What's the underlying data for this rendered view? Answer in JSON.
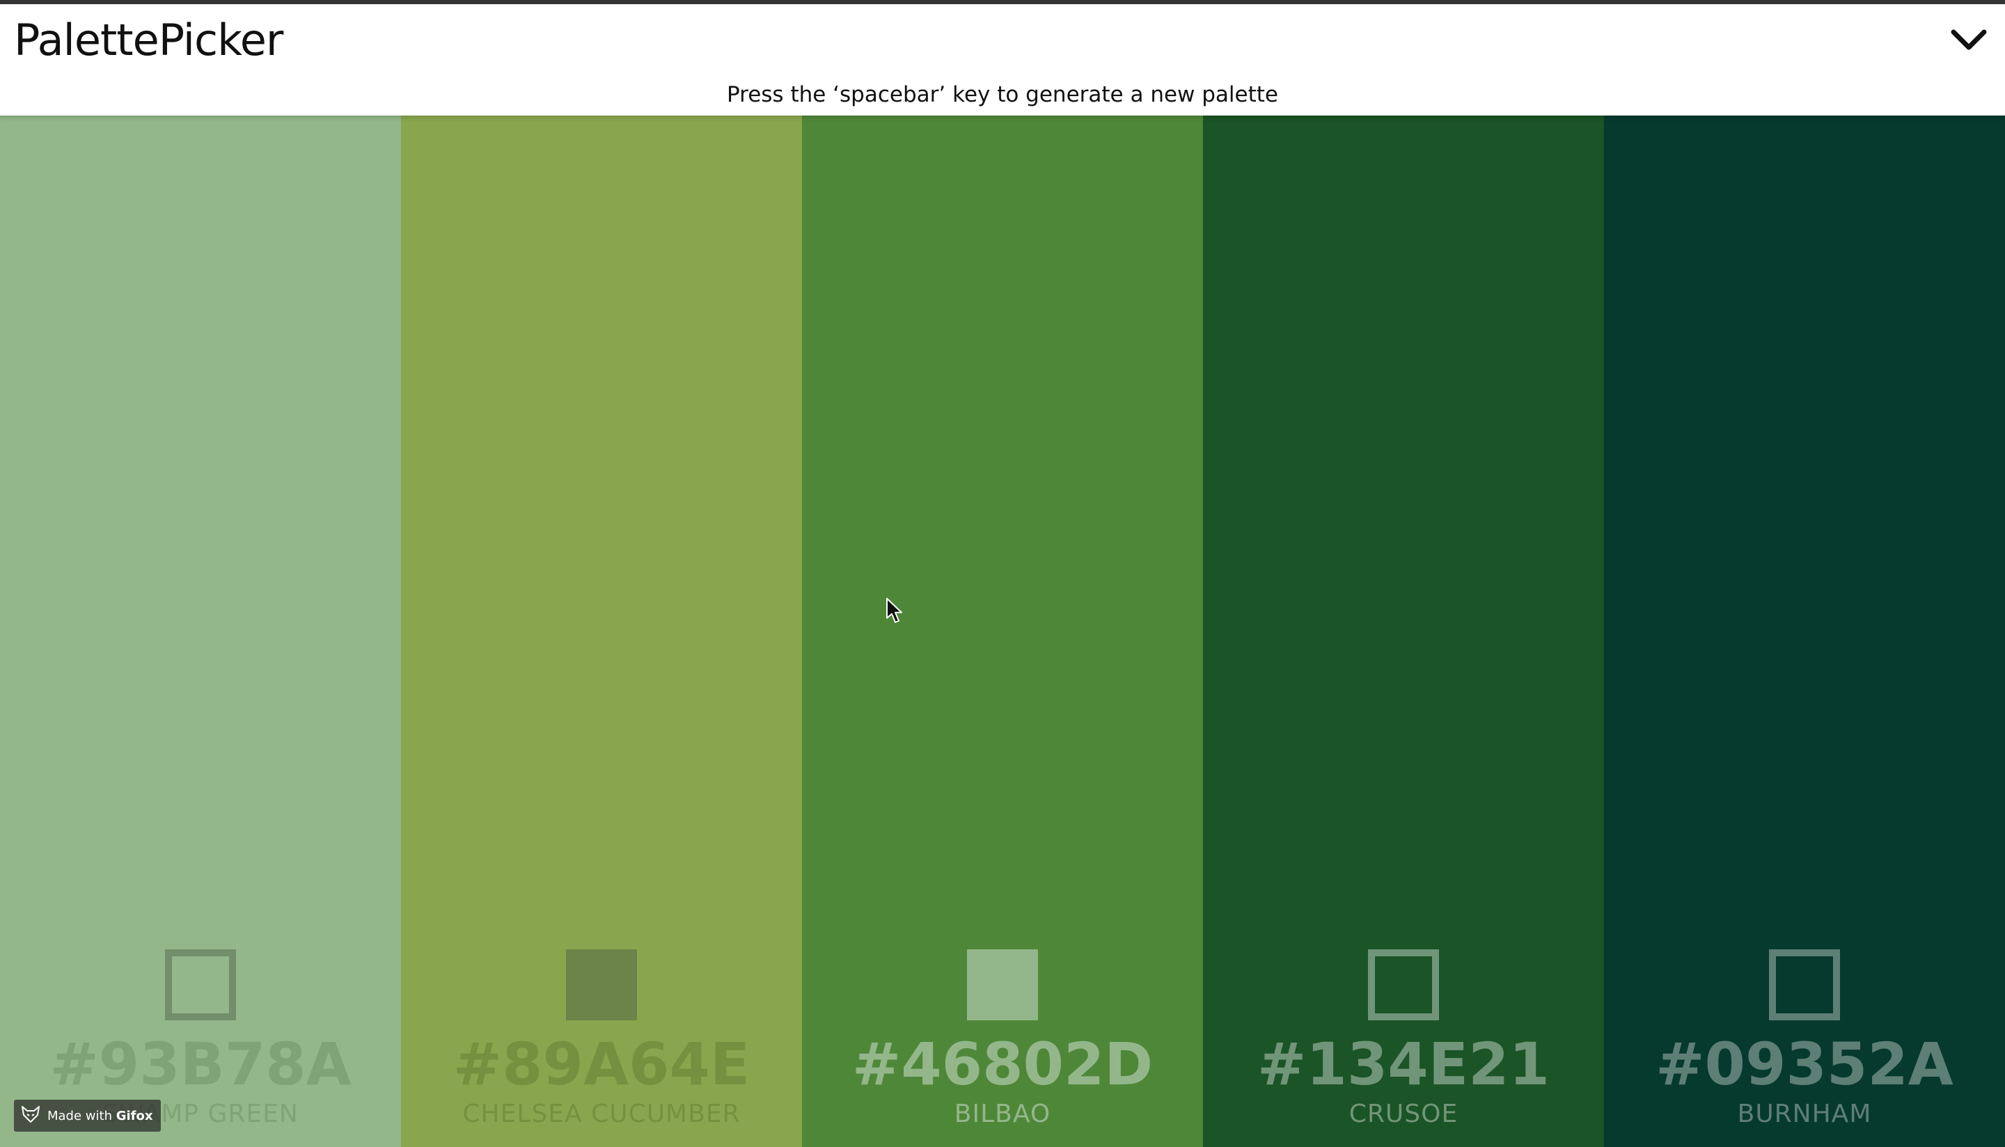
{
  "app": {
    "title": "PalettePicker",
    "hint": "Press the ‘spacebar’ key to generate a new palette"
  },
  "header": {
    "toggle_icon": "chevron-down-icon"
  },
  "palette": [
    {
      "hex": "#93B78A",
      "name": "SWAMP GREEN",
      "color": "#93B78A",
      "text_color": "#7FA377",
      "lock_state": "unlocked",
      "lock_color": "rgba(0,0,0,0.22)"
    },
    {
      "hex": "#89A64E",
      "name": "CHELSEA CUCUMBER",
      "color": "#89A64E",
      "text_color": "#75913F",
      "lock_state": "locked",
      "lock_color": "#6A8449"
    },
    {
      "hex": "#46802D",
      "name": "BILBAO",
      "color": "#4F8739",
      "text_color": "#93B78A",
      "lock_state": "locked",
      "lock_color": "#93B78A"
    },
    {
      "hex": "#134E21",
      "name": "CRUSOE",
      "color": "#1B5426",
      "text_color": "#719578",
      "lock_state": "unlocked",
      "lock_color": "#719578"
    },
    {
      "hex": "#09352A",
      "name": "BURNHAM",
      "color": "#073A2F",
      "text_color": "#5E7F76",
      "lock_state": "unlocked",
      "lock_color": "#5E7F76"
    }
  ],
  "badge": {
    "prefix": "Made with",
    "brand": "Gifox",
    "icon": "fox-icon"
  }
}
